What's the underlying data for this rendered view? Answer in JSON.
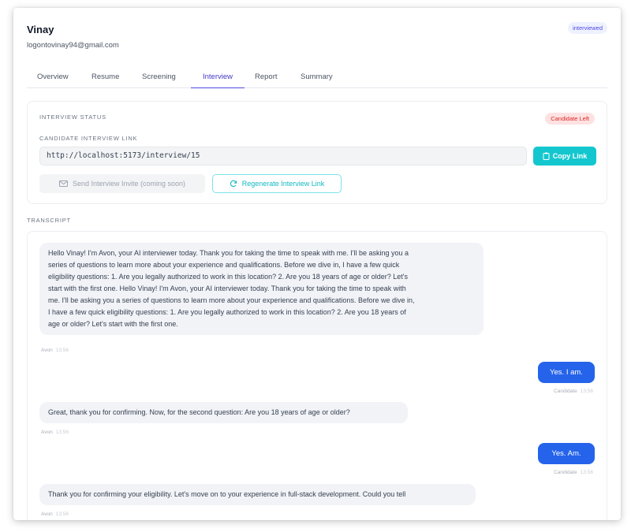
{
  "candidate": {
    "name": "Vinay",
    "email": "logontovinay94@gmail.com",
    "status_badge": "interviewed"
  },
  "tabs": [
    {
      "label": "Overview",
      "active": false
    },
    {
      "label": "Resume",
      "active": false
    },
    {
      "label": "Screening",
      "active": false
    },
    {
      "label": "Interview",
      "active": true
    },
    {
      "label": "Report",
      "active": false
    },
    {
      "label": "Summary",
      "active": false
    }
  ],
  "interview": {
    "status_label": "INTERVIEW STATUS",
    "status_value": "Candidate Left",
    "link_label": "CANDIDATE INTERVIEW LINK",
    "link_value": "http://localhost:5173/interview/15",
    "copy_button": "Copy Link",
    "send_invite_button": "Send Interview Invite (coming soon)",
    "regenerate_button": "Regenerate Interview Link"
  },
  "transcript": {
    "label": "TRANSCRIPT",
    "messages": [
      {
        "speaker": "Avon",
        "time": "13:56",
        "lines": [
          "Hello Vinay! I'm Avon, your AI interviewer today. Thank you for taking the time to speak with me. I'll be asking you a",
          "series of questions to learn more about your experience and qualifications. Before we dive in, I have a few quick",
          "eligibility questions: 1. Are you legally authorized to work in this location? 2. Are you 18 years of age or older? Let's",
          "start with the first one. Hello Vinay! I'm Avon, your AI interviewer today. Thank you for taking the time to speak with",
          "me. I'll be asking you a series of questions to learn more about your experience and qualifications. Before we dive in,",
          "I have a few quick eligibility questions: 1. Are you legally authorized to work in this location? 2. Are you 18 years of",
          "age or older? Let's start with the first one."
        ]
      },
      {
        "speaker": "Candidate",
        "time": "13:56",
        "text": "Yes. I am."
      },
      {
        "speaker": "Avon",
        "time": "13:56",
        "lines": [
          "Great, thank you for confirming. Now, for the second question: Are you 18 years of age or older?"
        ]
      },
      {
        "speaker": "Candidate",
        "time": "13:56",
        "text": "Yes. Am."
      },
      {
        "speaker": "Avon",
        "time": "13:56",
        "lines": [
          "Thank you for confirming your eligibility. Let's move on to your experience in full-stack development. Could you tell"
        ]
      }
    ]
  },
  "colors": {
    "accent": "#4f46e5",
    "teal": "#14c7cf",
    "user_bubble": "#2563eb",
    "danger": "#dc2626"
  }
}
